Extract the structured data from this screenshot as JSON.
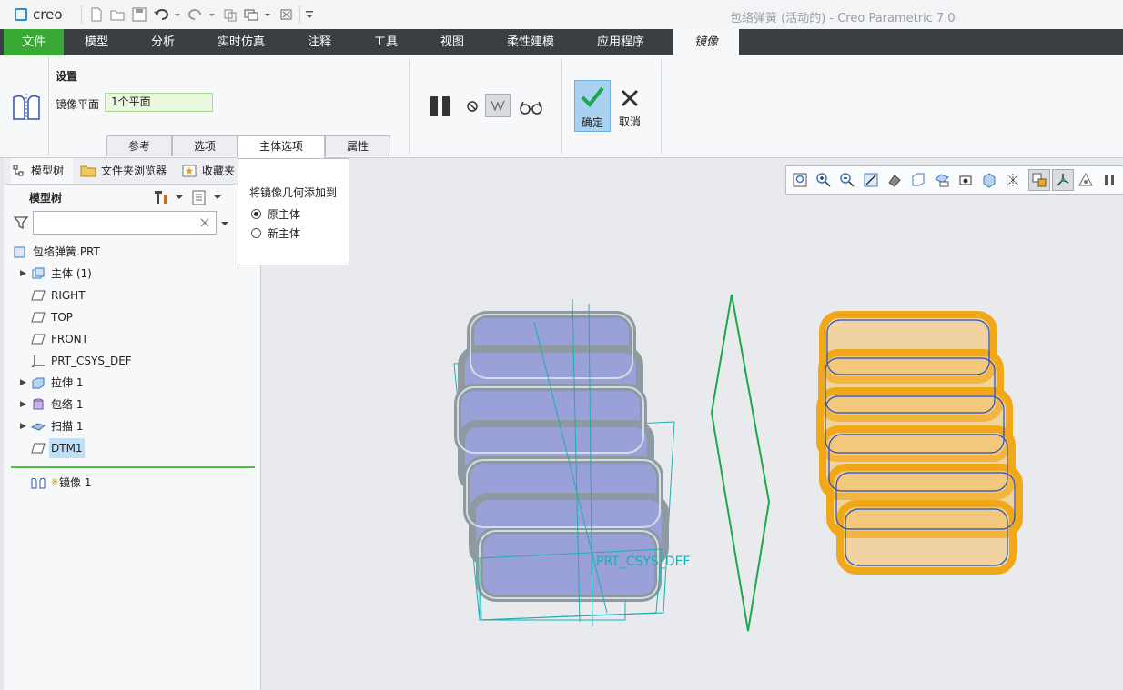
{
  "app": {
    "logo": "creo",
    "title": "包络弹簧 (活动的) - Creo Parametric 7.0"
  },
  "tabs": [
    {
      "label": "文件"
    },
    {
      "label": "模型"
    },
    {
      "label": "分析"
    },
    {
      "label": "实时仿真"
    },
    {
      "label": "注释"
    },
    {
      "label": "工具"
    },
    {
      "label": "视图"
    },
    {
      "label": "柔性建模"
    },
    {
      "label": "应用程序"
    },
    {
      "label": "镜像"
    }
  ],
  "ribbon": {
    "section_title": "设置",
    "mirror_plane_label": "镜像平面",
    "mirror_plane_value": "1个平面",
    "ok_label": "确定",
    "cancel_label": "取消",
    "subtabs": [
      {
        "label": "参考"
      },
      {
        "label": "选项"
      },
      {
        "label": "主体选项"
      },
      {
        "label": "属性"
      }
    ]
  },
  "popup": {
    "title": "将镜像几何添加到",
    "options": [
      {
        "label": "原主体",
        "selected": true
      },
      {
        "label": "新主体",
        "selected": false
      }
    ]
  },
  "panel": {
    "tabs": [
      {
        "label": "模型树"
      },
      {
        "label": "文件夹浏览器"
      },
      {
        "label": "收藏夹"
      }
    ],
    "tree_title": "模型树",
    "search_placeholder": "",
    "tree": [
      {
        "label": "包络弹簧.PRT",
        "icon": "part-icon",
        "expand": false
      },
      {
        "label": "主体 (1)",
        "icon": "body-icon",
        "expand": true
      },
      {
        "label": "RIGHT",
        "icon": "datum-plane-icon",
        "expand": false
      },
      {
        "label": "TOP",
        "icon": "datum-plane-icon",
        "expand": false
      },
      {
        "label": "FRONT",
        "icon": "datum-plane-icon",
        "expand": false
      },
      {
        "label": "PRT_CSYS_DEF",
        "icon": "csys-icon",
        "expand": false
      },
      {
        "label": "拉伸 1",
        "icon": "extrude-icon",
        "expand": true
      },
      {
        "label": "包络 1",
        "icon": "wrap-icon",
        "expand": true
      },
      {
        "label": "扫描 1",
        "icon": "sweep-icon",
        "expand": true
      },
      {
        "label": "DTM1",
        "icon": "datum-plane-icon",
        "expand": false,
        "highlighted": true
      }
    ],
    "insert_item": {
      "mark": "※",
      "label": "镜像 1",
      "icon": "mirror-icon"
    }
  },
  "viewport": {
    "csys_label": "PRT_CSYS_DEF"
  },
  "colors": {
    "tab_bg": "#3a3f44",
    "file_tab": "#3aa835",
    "selected_green": "#1aa84a",
    "spring_orange": "#f0a818",
    "spring_gray": "#a9b4bc",
    "teal": "#1ab0b0"
  }
}
